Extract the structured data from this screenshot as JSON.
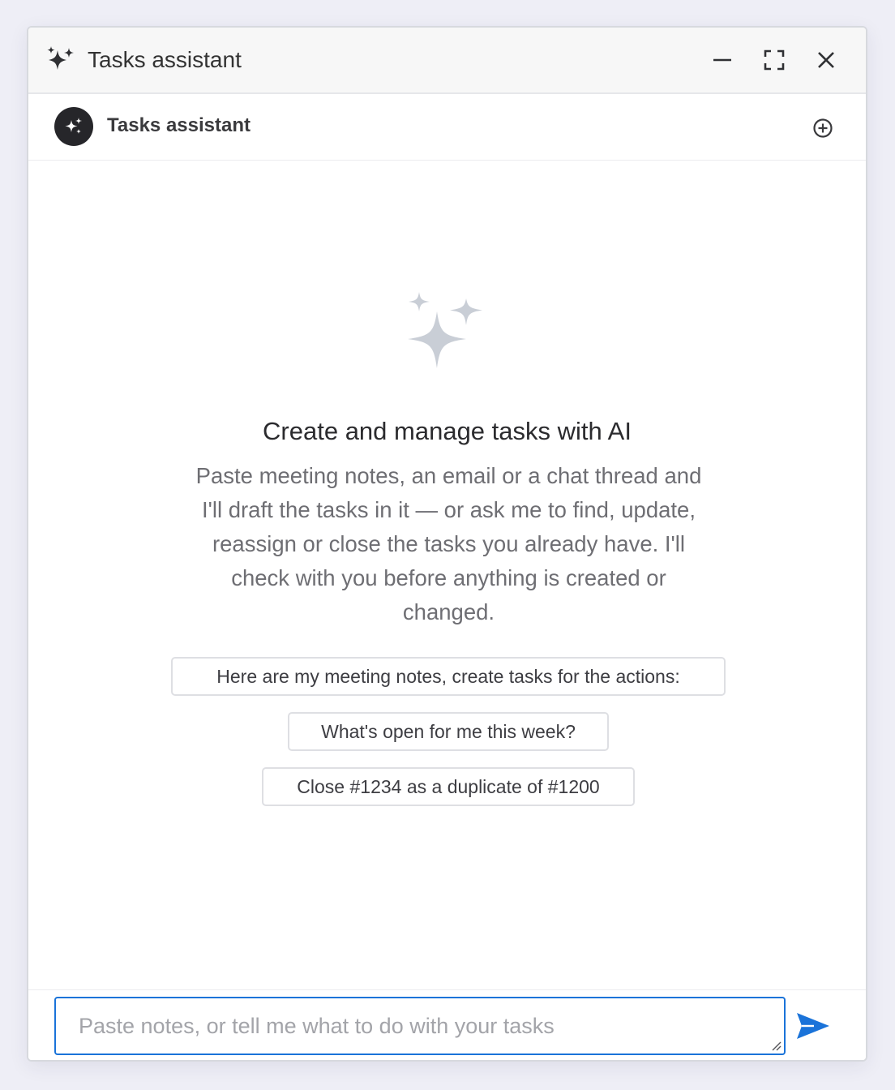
{
  "window": {
    "title": "Tasks assistant",
    "controls": {
      "minimize": "minimize-icon",
      "maximize": "maximize-icon",
      "close": "close-icon"
    }
  },
  "chat_header": {
    "assistant_name": "Tasks assistant",
    "avatar_icon": "sparkles-icon",
    "new_chat_icon": "plus-circle-icon"
  },
  "empty_state": {
    "icon": "sparkles-icon",
    "headline": "Create and manage tasks with AI",
    "description": "Paste meeting notes, an email or a chat thread and I'll draft the tasks in it — or ask me to find, update, reassign or close the tasks you already have. I'll check with you before anything is created or changed.",
    "suggestions": [
      "Here are my meeting notes, create tasks for the actions:",
      "What's open for me this week?",
      "Close #1234 as a duplicate of #1200"
    ]
  },
  "composer": {
    "placeholder": "Paste notes, or tell me what to do with your tasks",
    "value": "",
    "send_icon": "send-icon"
  },
  "colors": {
    "accent": "#1a73d9",
    "avatar_bg": "#26262a",
    "hero_icon": "#c9ced6",
    "titlebar_bg": "#f7f7f7",
    "page_bg": "#eeeef6"
  }
}
